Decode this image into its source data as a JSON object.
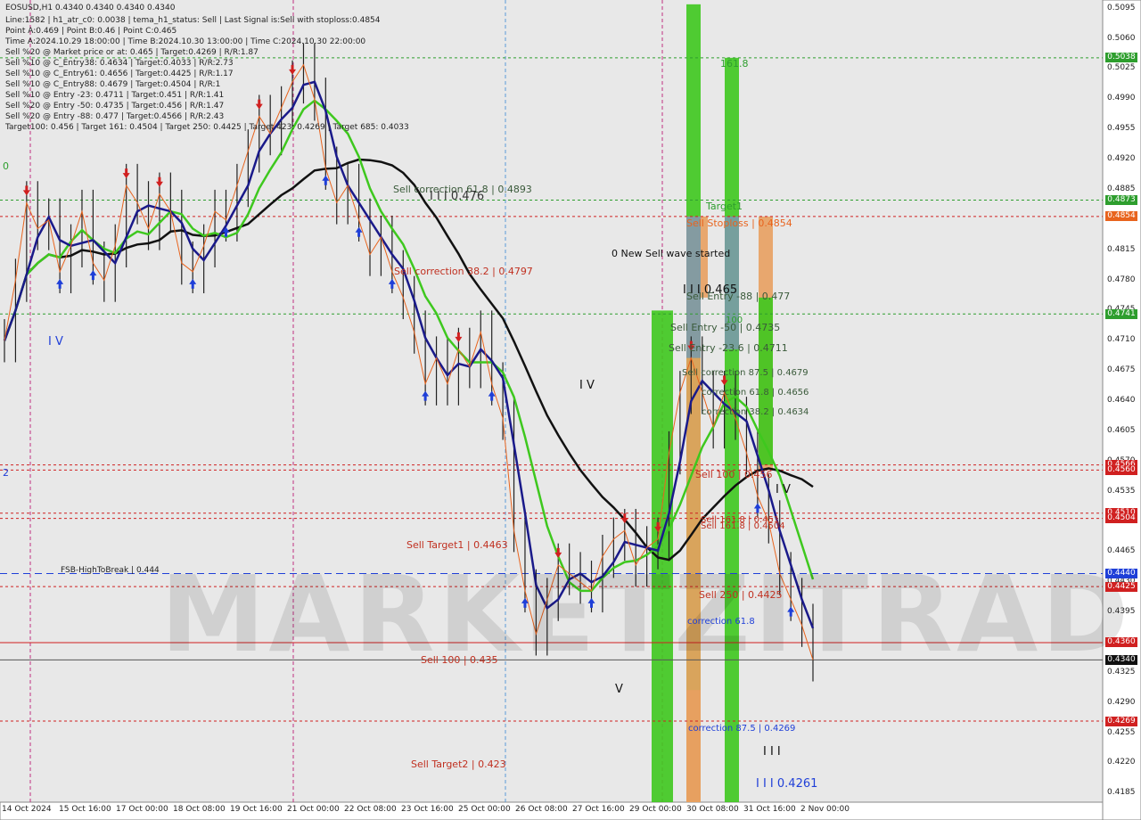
{
  "header": {
    "symbol_line": "EOSUSD,H1  0.4340 0.4340 0.4340 0.4340",
    "lines": [
      "Line:1582 | h1_atr_c0: 0.0038 | tema_h1_status: Sell | Last Signal is:Sell with stoploss:0.4854",
      "Point A:0.469 | Point B:0.46 | Point C:0.465",
      "Time A:2024.10.29 18:00:00 | Time B:2024.10.30 13:00:00 | Time C:2024.10.30 22:00:00",
      "Sell %20 @ Market price or at: 0.465 | Target:0.4269 | R/R:1.87",
      "Sell %10 @ C_Entry38: 0.4634 | Target:0.4033 | R/R:2.73",
      "Sell %10 @ C_Entry61: 0.4656 | Target:0.4425 | R/R:1.17",
      "Sell %10 @ C_Entry88: 0.4679 | Target:0.4504 | R/R:1",
      "Sell %10 @ Entry -23: 0.4711 | Target:0.451 | R/R:1.41",
      "Sell %20 @ Entry -50: 0.4735 | Target:0.456 | R/R:1.47",
      "Sell %20 @ Entry -88: 0.477 | Target:0.4566 | R/R:2.43",
      "Target100: 0.456 | Target 161: 0.4504 | Target 250: 0.4425 | Target 423: 0.4269 | Target 685: 0.4033"
    ]
  },
  "price_axis": {
    "ticks": [
      "0.5095",
      "0.5060",
      "0.5025",
      "0.4990",
      "0.4955",
      "0.4920",
      "0.4885",
      "0.4850",
      "0.4815",
      "0.4780",
      "0.4745",
      "0.4710",
      "0.4675",
      "0.4640",
      "0.4605",
      "0.4570",
      "0.4535",
      "0.4500",
      "0.4465",
      "0.4430",
      "0.4395",
      "0.4360",
      "0.4325",
      "0.4290",
      "0.4255",
      "0.4220",
      "0.4185"
    ],
    "tags": [
      {
        "label": "0.5038",
        "value": 0.5038,
        "color": "#2e9e2e"
      },
      {
        "label": "0.4873",
        "value": 0.4873,
        "color": "#2e9e2e"
      },
      {
        "label": "0.4854",
        "value": 0.4854,
        "color": "#e8641e"
      },
      {
        "label": "0.4741",
        "value": 0.4741,
        "color": "#2e9e2e"
      },
      {
        "label": "0.4566",
        "value": 0.4566,
        "color": "#d02020"
      },
      {
        "label": "0.4560",
        "value": 0.456,
        "color": "#d02020"
      },
      {
        "label": "0.4510",
        "value": 0.451,
        "color": "#d02020"
      },
      {
        "label": "0.4504",
        "value": 0.4504,
        "color": "#d02020"
      },
      {
        "label": "0.4440",
        "value": 0.444,
        "color": "#1f3fd8"
      },
      {
        "label": "0.4425",
        "value": 0.4425,
        "color": "#d02020"
      },
      {
        "label": "0.4360",
        "value": 0.436,
        "color": "#d02020"
      },
      {
        "label": "0.4340",
        "value": 0.434,
        "color": "#111111"
      },
      {
        "label": "0.4269",
        "value": 0.4269,
        "color": "#d02020"
      }
    ]
  },
  "time_axis": [
    "14 Oct 2024",
    "15 Oct 16:00",
    "17 Oct 00:00",
    "18 Oct 08:00",
    "19 Oct 16:00",
    "21 Oct 00:00",
    "22 Oct 08:00",
    "23 Oct 16:00",
    "25 Oct 00:00",
    "26 Oct 08:00",
    "27 Oct 16:00",
    "29 Oct 00:00",
    "30 Oct 08:00",
    "31 Oct 16:00",
    "2 Nov 00:00"
  ],
  "annotations": {
    "sell_correction_618": "Sell correction 61.8 | 0.4893",
    "iii_0476": "I I I 0.476",
    "sell_correction_382": "Sell correction 38.2 | 0.4797",
    "new_sell_wave": "0 New Sell wave started",
    "target1": "Target1",
    "sell_stoploss": "Sell Stoploss | 0.4854",
    "iii_0465": "I I I 0.465",
    "sell_entry_88": "Sell Entry -88 | 0.477",
    "sell_entry_50": "Sell Entry -50 | 0.4735",
    "sell_entry_236": "Sell Entry -23.6 | 0.4711",
    "corr_875": "Sell correction 87.5 | 0.4679",
    "corr_618": "correction 61.8 | 0.4656",
    "corr_382": "correction 38.2 | 0.4634",
    "sell_100_0456": "Sell 100 | 0.456",
    "sell_0451": "Sell 161.8 | 0.451",
    "sell_0504": "Sell 161.8 | 0.4504",
    "sell_target1": "Sell Target1 | 0.4463",
    "fsb": "FSB-HighToBreak | 0.444",
    "sell_250": "Sell 250 | 0.4425",
    "correction_618_low": "correction 61.8",
    "sell_100": "Sell 100 | 0.435",
    "v_label": "V",
    "corr_875_low": "correction 87.5 | 0.4269",
    "sell_target2": "Sell Target2 | 0.423",
    "iii_04261": "I I I 0.4261",
    "iii_low": "I I I",
    "iv_left": "I V",
    "iv_mid": "I V",
    "iv_right": "I V",
    "label_1618": "161.8",
    "label_100": "100",
    "left_0": "0",
    "left_2": "2"
  },
  "watermark": "MARKETZITRADE",
  "chart_data": {
    "type": "line",
    "title": "EOSUSD,H1",
    "ylim": [
      0.4175,
      0.5105
    ],
    "series": [
      {
        "name": "price",
        "values": [
          0.471,
          0.478,
          0.487,
          0.484,
          0.485,
          0.479,
          0.482,
          0.486,
          0.48,
          0.478,
          0.482,
          0.489,
          0.487,
          0.484,
          0.488,
          0.486,
          0.48,
          0.479,
          0.482,
          0.486,
          0.485,
          0.489,
          0.493,
          0.497,
          0.495,
          0.498,
          0.501,
          0.503,
          0.499,
          0.491,
          0.487,
          0.489,
          0.485,
          0.481,
          0.483,
          0.479,
          0.476,
          0.472,
          0.466,
          0.469,
          0.466,
          0.47,
          0.468,
          0.472,
          0.466,
          0.462,
          0.449,
          0.442,
          0.437,
          0.441,
          0.445,
          0.444,
          0.443,
          0.442,
          0.446,
          0.448,
          0.449,
          0.445,
          0.447,
          0.448,
          0.458,
          0.465,
          0.469,
          0.465,
          0.461,
          0.465,
          0.462,
          0.458,
          0.453,
          0.45,
          0.444,
          0.441,
          0.438,
          0.434
        ]
      }
    ]
  }
}
